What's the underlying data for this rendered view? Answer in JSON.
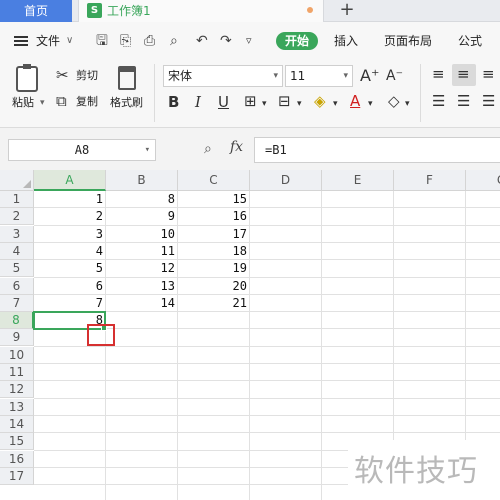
{
  "tabs": {
    "home": "首页",
    "workbook_icon": "S",
    "workbook": "工作簿1",
    "new_tab": "+"
  },
  "menu": {
    "file": "文件",
    "start": "开始",
    "insert": "插入",
    "page_layout": "页面布局",
    "formula": "公式"
  },
  "ribbon": {
    "paste": "粘贴",
    "cut": "剪切",
    "copy": "复制",
    "format_painter": "格式刷",
    "font_name": "宋体",
    "font_size": "11",
    "bold": "B",
    "italic": "I",
    "underline": "U",
    "grow_font": "A⁺",
    "shrink_font": "A⁻"
  },
  "formula_bar": {
    "name_box": "A8",
    "fx": "fx",
    "formula": "=B1"
  },
  "columns": [
    "A",
    "B",
    "C",
    "D",
    "E",
    "F",
    "G"
  ],
  "rows": [
    "1",
    "2",
    "3",
    "4",
    "5",
    "6",
    "7",
    "8",
    "9",
    "10",
    "11",
    "12",
    "13",
    "14",
    "15",
    "16",
    "17"
  ],
  "cells": {
    "A": [
      "1",
      "2",
      "3",
      "4",
      "5",
      "6",
      "7"
    ],
    "B": [
      "8",
      "9",
      "10",
      "11",
      "12",
      "13",
      "14"
    ],
    "C": [
      "15",
      "16",
      "17",
      "18",
      "19",
      "20",
      "21"
    ],
    "A8": "8"
  },
  "active_cell": "A8",
  "watermark": "软件技巧",
  "colors": {
    "accent": "#3aa65b",
    "home_tab": "#4a7fe1",
    "highlight": "#d63030"
  }
}
